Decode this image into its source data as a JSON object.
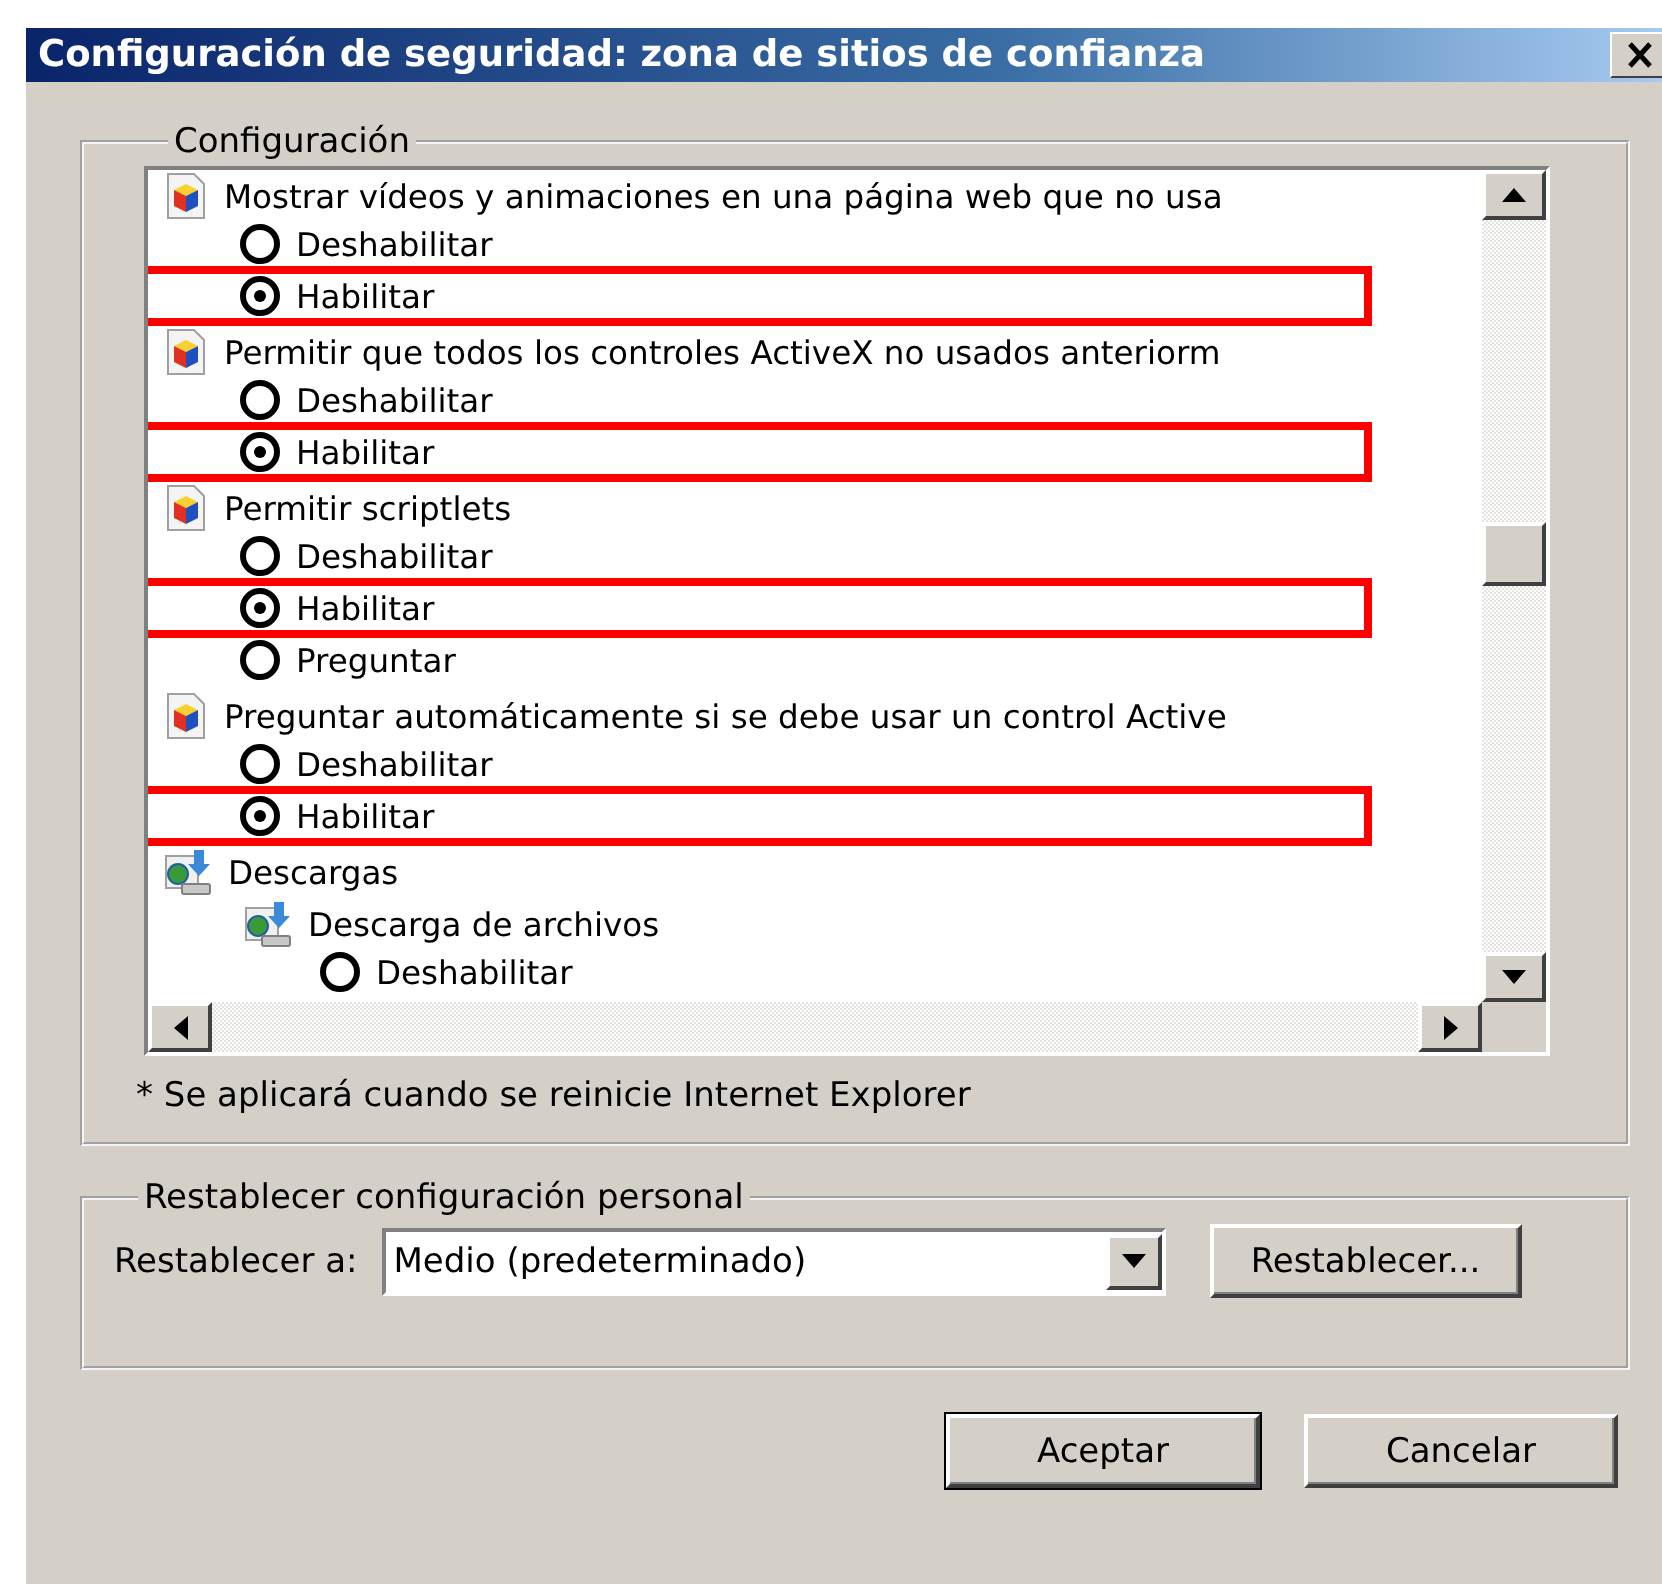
{
  "window": {
    "title": "Configuración de seguridad: zona de sitios de confianza"
  },
  "settings_group": {
    "title": "Configuración",
    "tree": [
      {
        "kind": "activex-setting",
        "label": "Mostrar vídeos y animaciones en una página web que no usa",
        "children": [
          {
            "kind": "option",
            "label": "Deshabilitar",
            "selected": false,
            "highlighted": false
          },
          {
            "kind": "option",
            "label": "Habilitar",
            "selected": true,
            "highlighted": true
          }
        ]
      },
      {
        "kind": "activex-setting",
        "label": "Permitir que todos los controles ActiveX no usados anteriorm",
        "children": [
          {
            "kind": "option",
            "label": "Deshabilitar",
            "selected": false,
            "highlighted": false
          },
          {
            "kind": "option",
            "label": "Habilitar",
            "selected": true,
            "highlighted": true
          }
        ]
      },
      {
        "kind": "activex-setting",
        "label": "Permitir scriptlets",
        "children": [
          {
            "kind": "option",
            "label": "Deshabilitar",
            "selected": false,
            "highlighted": false
          },
          {
            "kind": "option",
            "label": "Habilitar",
            "selected": true,
            "highlighted": true
          },
          {
            "kind": "option",
            "label": "Preguntar",
            "selected": false,
            "highlighted": false
          }
        ]
      },
      {
        "kind": "activex-setting",
        "label": "Preguntar automáticamente si se debe usar un control Active",
        "children": [
          {
            "kind": "option",
            "label": "Deshabilitar",
            "selected": false,
            "highlighted": false
          },
          {
            "kind": "option",
            "label": "Habilitar",
            "selected": true,
            "highlighted": true
          }
        ]
      },
      {
        "kind": "category",
        "label": "Descargas",
        "children": [
          {
            "kind": "download-setting",
            "label": "Descarga de archivos",
            "children": [
              {
                "kind": "option",
                "label": "Deshabilitar",
                "selected": false,
                "highlighted": false
              }
            ]
          }
        ]
      }
    ],
    "note": "* Se aplicará cuando se reinicie Internet Explorer"
  },
  "reset_group": {
    "title": "Restablecer configuración personal",
    "label": "Restablecer a:",
    "dropdown": {
      "value": "Medio (predeterminado)"
    },
    "button": "Restablecer..."
  },
  "buttons": [
    {
      "label": "Aceptar",
      "default": true
    },
    {
      "label": "Cancelar",
      "default": false
    }
  ]
}
